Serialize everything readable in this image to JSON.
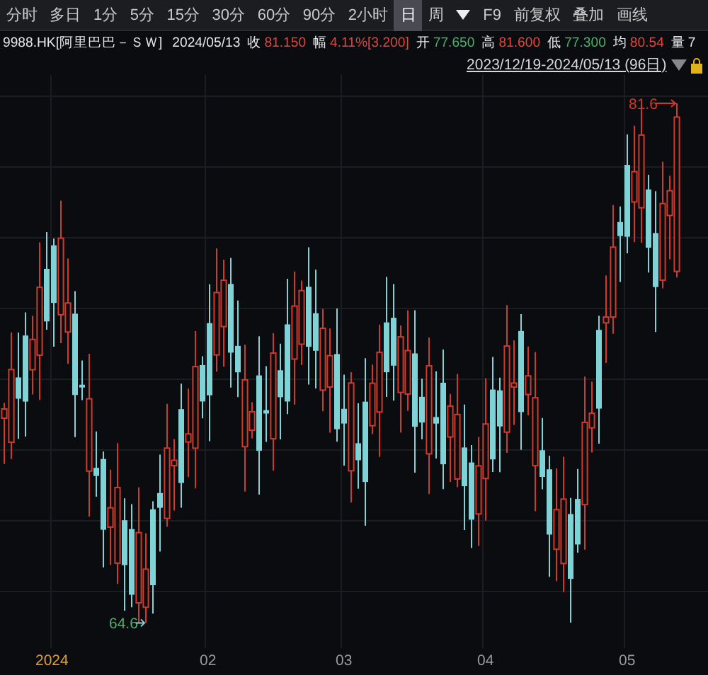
{
  "toolbar": {
    "tabs": [
      {
        "label": "分时",
        "selected": false
      },
      {
        "label": "多日",
        "selected": false
      },
      {
        "label": "1分",
        "selected": false
      },
      {
        "label": "5分",
        "selected": false
      },
      {
        "label": "15分",
        "selected": false
      },
      {
        "label": "30分",
        "selected": false
      },
      {
        "label": "60分",
        "selected": false
      },
      {
        "label": "90分",
        "selected": false
      },
      {
        "label": "2小时",
        "selected": false
      },
      {
        "label": "日",
        "selected": true
      },
      {
        "label": "周",
        "selected": false
      }
    ],
    "extra_buttons": [
      "F9",
      "前复权",
      "叠加",
      "画线"
    ]
  },
  "quote": {
    "symbol": "9988.HK[阿里巴巴－ＳＷ]",
    "date": "2024/05/13",
    "fields": [
      {
        "label": "收",
        "value": "81.150",
        "color": "#e0463a"
      },
      {
        "label": "幅",
        "value": "4.11%[3.200]",
        "color": "#e0463a"
      },
      {
        "label": "开",
        "value": "77.650",
        "color": "#4caf6a"
      },
      {
        "label": "高",
        "value": "81.600",
        "color": "#e0463a"
      },
      {
        "label": "低",
        "value": "77.300",
        "color": "#4caf6a"
      },
      {
        "label": "均",
        "value": "80.54",
        "color": "#e0463a"
      },
      {
        "label": "量",
        "value": "7",
        "color": "#e6e6e6"
      }
    ]
  },
  "range": {
    "text": "2023/12/19-2024/05/13 (96日)"
  },
  "chart": {
    "high_label": "81.6",
    "low_label": "64.6",
    "x_labels": [
      {
        "text": "2024",
        "kind": "year"
      },
      {
        "text": "02",
        "kind": "month"
      },
      {
        "text": "03",
        "kind": "month"
      },
      {
        "text": "04",
        "kind": "month"
      },
      {
        "text": "05",
        "kind": "month"
      }
    ]
  }
}
